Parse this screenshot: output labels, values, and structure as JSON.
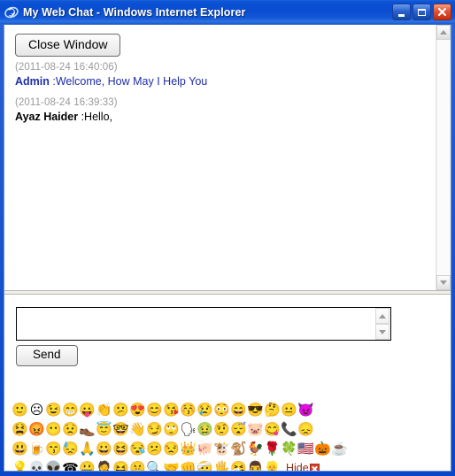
{
  "window": {
    "title": "My Web Chat - Windows Internet Explorer",
    "app_icon": "internet-explorer-icon",
    "titlebar_color": "#0a4ccf",
    "controls": {
      "minimize": "minimize-button",
      "maximize": "maximize-button",
      "close": "close-button"
    }
  },
  "chat": {
    "close_window_label": "Close Window",
    "messages": [
      {
        "timestamp": "(2011-08-24 16:40:06)",
        "sender": "Admin",
        "separator": " :",
        "text": "Welcome, How May I Help You",
        "sender_color": "#1f2fa8",
        "text_color": "#1f2fa8"
      },
      {
        "timestamp": "(2011-08-24 16:39:33)",
        "sender": "Ayaz Haider",
        "separator": " :",
        "text": "Hello,",
        "sender_color": "#000000",
        "text_color": "#000000"
      }
    ],
    "scrollbar": {
      "up_arrow": "scroll-up-arrow-icon",
      "down_arrow": "scroll-down-arrow-icon"
    }
  },
  "composer": {
    "input_value": "",
    "input_placeholder": "",
    "send_label": "Send",
    "spinner_up": "spinner-up-icon",
    "spinner_down": "spinner-down-icon"
  },
  "emoticons": {
    "hide_label": "Hide",
    "hide_icon": "close-x-icon",
    "rows": [
      [
        {
          "name": "smile",
          "glyph": "🙂"
        },
        {
          "name": "sad",
          "glyph": "☹"
        },
        {
          "name": "wink",
          "glyph": "😉"
        },
        {
          "name": "big-grin",
          "glyph": "😁"
        },
        {
          "name": "tongue-out",
          "glyph": "😛"
        },
        {
          "name": "clapping-hands",
          "glyph": "👏"
        },
        {
          "name": "confused",
          "glyph": "😕"
        },
        {
          "name": "love-struck",
          "glyph": "😍"
        },
        {
          "name": "blushing",
          "glyph": "😊"
        },
        {
          "name": "kissing",
          "glyph": "😘"
        },
        {
          "name": "heart-kiss",
          "glyph": "😚"
        },
        {
          "name": "crying",
          "glyph": "😢"
        },
        {
          "name": "pink-smile",
          "glyph": "😳"
        },
        {
          "name": "laughing",
          "glyph": "😄"
        },
        {
          "name": "cool-sunglasses",
          "glyph": "😎"
        },
        {
          "name": "thinking",
          "glyph": "🤔"
        },
        {
          "name": "straight-face",
          "glyph": "😐"
        },
        {
          "name": "devil",
          "glyph": "😈"
        }
      ],
      [
        {
          "name": "yawning",
          "glyph": "😫"
        },
        {
          "name": "shouting",
          "glyph": "😡"
        },
        {
          "name": "neutral",
          "glyph": "😶"
        },
        {
          "name": "worried",
          "glyph": "😟"
        },
        {
          "name": "shoe-throw",
          "glyph": "👞"
        },
        {
          "name": "angel",
          "glyph": "😇"
        },
        {
          "name": "nerd-glasses",
          "glyph": "🤓"
        },
        {
          "name": "waving-hand",
          "glyph": "👋"
        },
        {
          "name": "smirk",
          "glyph": "😏"
        },
        {
          "name": "rolling-eyes",
          "glyph": "🙄"
        },
        {
          "name": "talking",
          "glyph": "🗣"
        },
        {
          "name": "sick-green",
          "glyph": "🤢"
        },
        {
          "name": "thinking-hand",
          "glyph": "🤨"
        },
        {
          "name": "sleeping",
          "glyph": "😴"
        },
        {
          "name": "pig-face",
          "glyph": "🐷"
        },
        {
          "name": "eating",
          "glyph": "😋"
        },
        {
          "name": "phone-call",
          "glyph": "📞"
        },
        {
          "name": "sad-face",
          "glyph": "😞"
        }
      ],
      [
        {
          "name": "big-laugh",
          "glyph": "😃"
        },
        {
          "name": "drinking",
          "glyph": "🍺"
        },
        {
          "name": "whistling",
          "glyph": "😙"
        },
        {
          "name": "sweating",
          "glyph": "😓"
        },
        {
          "name": "praying-hands",
          "glyph": "🙏"
        },
        {
          "name": "grin",
          "glyph": "😀"
        },
        {
          "name": "squinting",
          "glyph": "😆"
        },
        {
          "name": "sleepy",
          "glyph": "😪"
        },
        {
          "name": "unsure",
          "glyph": "😕"
        },
        {
          "name": "annoyed",
          "glyph": "😒"
        },
        {
          "name": "king-crown",
          "glyph": "👑"
        },
        {
          "name": "pig",
          "glyph": "🐖"
        },
        {
          "name": "cow",
          "glyph": "🐮"
        },
        {
          "name": "monkey",
          "glyph": "🐒"
        },
        {
          "name": "rooster",
          "glyph": "🐓"
        },
        {
          "name": "rose",
          "glyph": "🌹"
        },
        {
          "name": "four-leaf-clover",
          "glyph": "🍀"
        },
        {
          "name": "usa-flag",
          "glyph": "🇺🇸"
        },
        {
          "name": "pumpkin",
          "glyph": "🎃"
        },
        {
          "name": "coffee-cup",
          "glyph": "☕"
        }
      ],
      [
        {
          "name": "light-bulb",
          "glyph": "💡"
        },
        {
          "name": "skull",
          "glyph": "💀"
        },
        {
          "name": "alien",
          "glyph": "👽"
        },
        {
          "name": "telephone",
          "glyph": "☎"
        },
        {
          "name": "zipper-mouth",
          "glyph": "🤐"
        },
        {
          "name": "facepalm",
          "glyph": "🤦"
        },
        {
          "name": "silly",
          "glyph": "😝"
        },
        {
          "name": "whispering",
          "glyph": "🤫"
        },
        {
          "name": "magnifier",
          "glyph": "🔍"
        },
        {
          "name": "handshake",
          "glyph": "🤝"
        },
        {
          "name": "punch",
          "glyph": "👊"
        },
        {
          "name": "tooth-ache",
          "glyph": "🤕"
        },
        {
          "name": "high-five",
          "glyph": "🖐"
        },
        {
          "name": "sneezing",
          "glyph": "🤧"
        },
        {
          "name": "boy-graduate",
          "glyph": "👨"
        },
        {
          "name": "blonde-girl",
          "glyph": "👱"
        }
      ]
    ]
  }
}
